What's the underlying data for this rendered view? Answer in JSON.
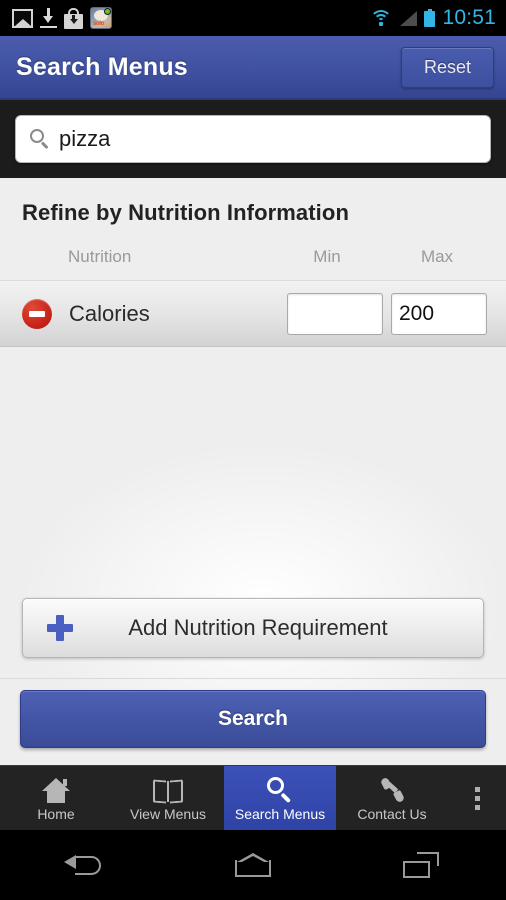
{
  "statusbar": {
    "time": "10:51",
    "left_icons": [
      "image-icon",
      "download-icon",
      "app-install-bag-icon",
      "app-notification-icon"
    ],
    "right_icons": [
      "wifi-icon",
      "cell-signal-icon",
      "battery-icon"
    ],
    "accent_color": "#33b5e5"
  },
  "actionbar": {
    "title": "Search Menus",
    "reset_label": "Reset",
    "color": "#3f51a0"
  },
  "search": {
    "value": "pizza",
    "placeholder": "Search",
    "icon": "search-icon"
  },
  "refine": {
    "section_title": "Refine by Nutrition Information",
    "columns": {
      "nutrition": "Nutrition",
      "min": "Min",
      "max": "Max"
    },
    "rows": [
      {
        "remove_icon": "remove-circle-icon",
        "label": "Calories",
        "min_value": "",
        "max_value": "200",
        "min_placeholder": "",
        "max_placeholder": ""
      }
    ]
  },
  "actions": {
    "add_label": "Add Nutrition Requirement",
    "add_icon": "plus-icon",
    "search_label": "Search",
    "search_color": "#4356a6"
  },
  "tabbar": {
    "items": [
      {
        "label": "Home",
        "icon": "home-icon",
        "active": false
      },
      {
        "label": "View Menus",
        "icon": "book-icon",
        "active": false
      },
      {
        "label": "Search Menus",
        "icon": "search-icon",
        "active": true
      },
      {
        "label": "Contact Us",
        "icon": "phone-icon",
        "active": false
      }
    ],
    "overflow_icon": "overflow-menu-icon",
    "active_color": "#3343ae"
  },
  "navbar": {
    "back": "back-icon",
    "home": "home-icon",
    "recents": "recents-icon"
  }
}
